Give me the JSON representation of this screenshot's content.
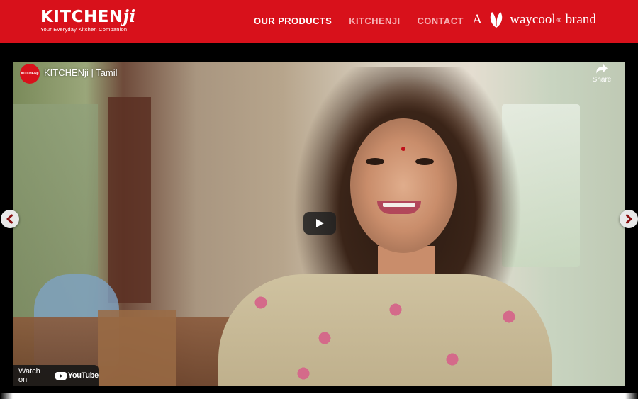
{
  "header": {
    "logo_text_main": "KITCHEN",
    "logo_text_ji": "ji",
    "logo_tagline": "Your Everyday Kitchen Companion",
    "nav": [
      {
        "label": "OUR PRODUCTS"
      },
      {
        "label": "KITCHENJI"
      },
      {
        "label": "CONTACT"
      }
    ],
    "brand_prefix": "A",
    "brand_name": "waycool",
    "brand_reg": "®",
    "brand_suffix": "brand",
    "colors": {
      "bar": "#d8111b",
      "nav_dim": "#f6b0b3"
    }
  },
  "video": {
    "channel_avatar_text": "KITCHENji",
    "title": "KITCHENji | Tamil",
    "share_label": "Share",
    "watch_on_label": "Watch on",
    "youtube_label": "YouTube",
    "play_icon": "play-icon"
  },
  "carousel": {
    "prev_icon": "chevron-left-icon",
    "next_icon": "chevron-right-icon"
  }
}
